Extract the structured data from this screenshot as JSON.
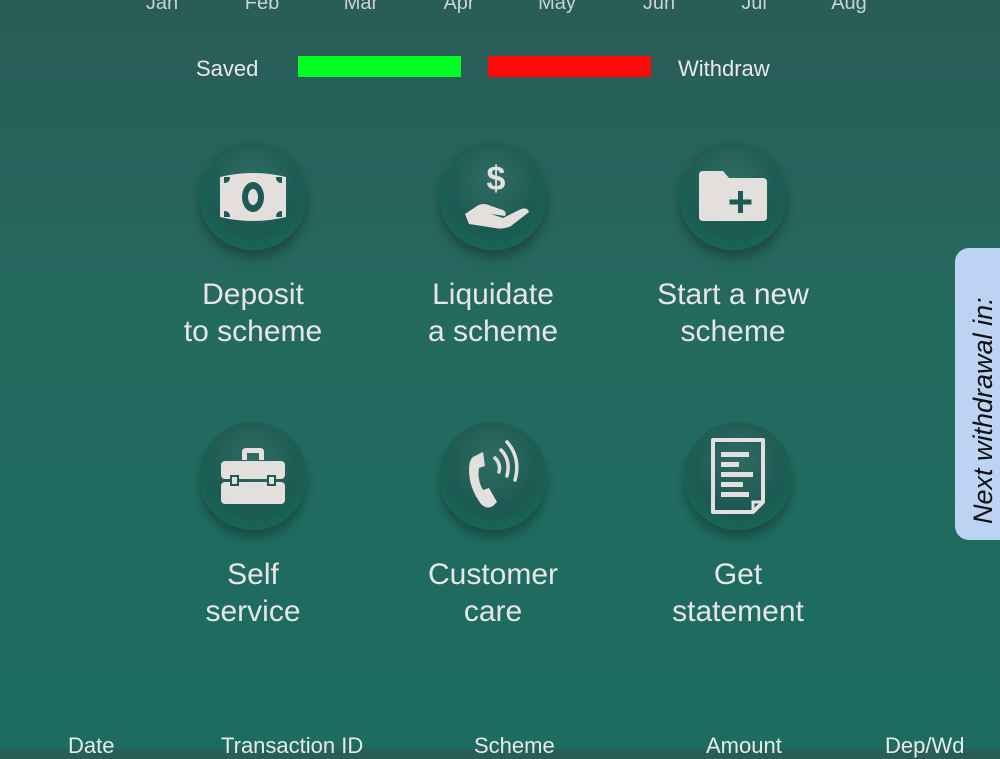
{
  "chart": {
    "months": [
      "Jan",
      "Feb",
      "Mar",
      "Apr",
      "May",
      "Jun",
      "Jul",
      "Aug"
    ],
    "legend": {
      "saved_label": "Saved",
      "saved_color": "#00ff22",
      "withdraw_label": "Withdraw",
      "withdraw_color": "#ff0a0a"
    }
  },
  "actions": [
    {
      "line1": "Deposit",
      "line2": "to scheme",
      "icon": "cash-icon"
    },
    {
      "line1": "Liquidate",
      "line2": "a scheme",
      "icon": "hand-dollar-icon"
    },
    {
      "line1": "Start a new",
      "line2": "scheme",
      "icon": "folder-plus-icon"
    },
    {
      "line1": "Self",
      "line2": "service",
      "icon": "toolbox-icon"
    },
    {
      "line1": "Customer",
      "line2": "care",
      "icon": "phone-icon"
    },
    {
      "line1": "Get",
      "line2": "statement",
      "icon": "statement-icon"
    }
  ],
  "side_tab": {
    "label": "Next withdrawal in:"
  },
  "table": {
    "headers": [
      "Date",
      "Transaction ID",
      "Scheme",
      "Amount",
      "Dep/Wd"
    ]
  },
  "colors": {
    "accent_text": "#e6e6e6",
    "side_tab_bg": "#bcd3f3"
  }
}
